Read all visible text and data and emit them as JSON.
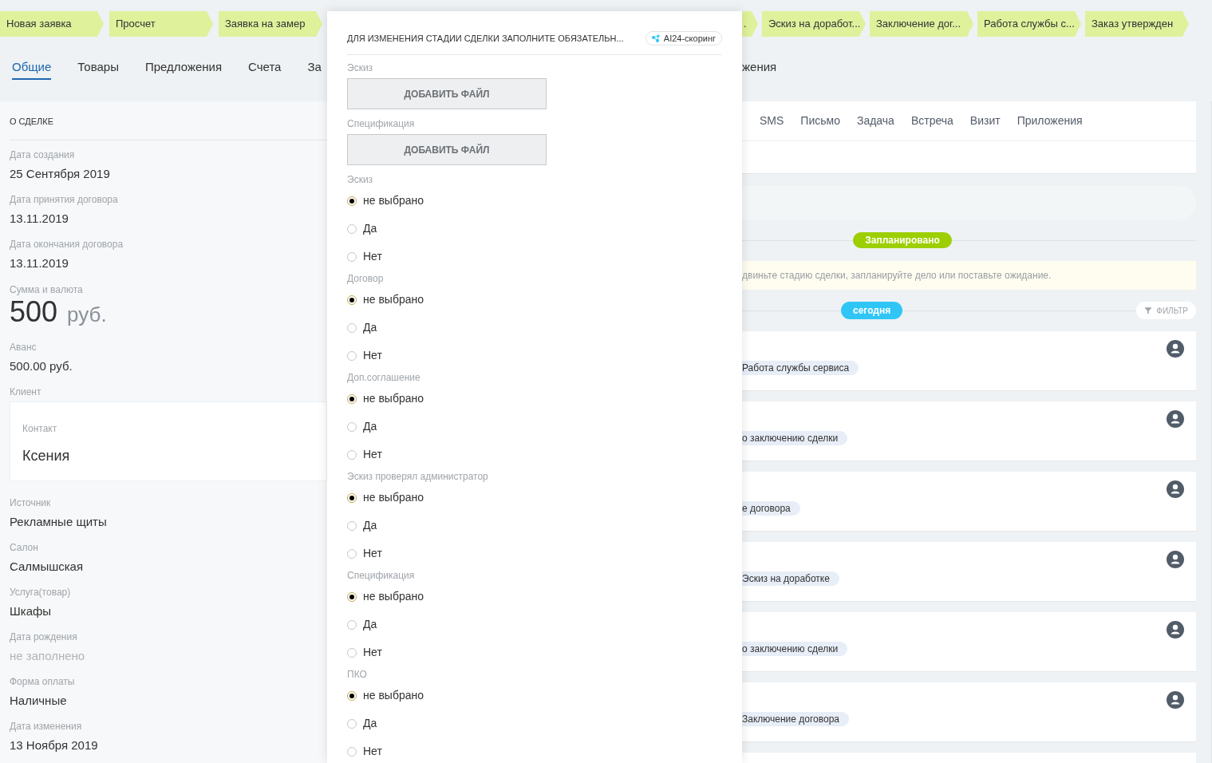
{
  "stages_left": [
    {
      "label": "Новая заявка"
    },
    {
      "label": "Просчет"
    },
    {
      "label": "Заявка на замер"
    }
  ],
  "stages_right": [
    {
      "label": "."
    },
    {
      "label": "Эскиз на доработ..."
    },
    {
      "label": "Заключение дог..."
    },
    {
      "label": "Работа службы с..."
    },
    {
      "label": "Заказ утвержден"
    }
  ],
  "tabs": [
    {
      "label": "Общие",
      "selected": true
    },
    {
      "label": "Товары",
      "selected": false
    },
    {
      "label": "Предложения",
      "selected": false
    },
    {
      "label": "Счета",
      "selected": false
    },
    {
      "label": "За",
      "selected": false
    }
  ],
  "tabs_right": [
    {
      "label": "жения",
      "selected": false
    }
  ],
  "deal": {
    "title": "О СДЕЛКЕ",
    "fields": [
      {
        "kind": "text",
        "label": "Дата создания",
        "value": "25 Сентября 2019"
      },
      {
        "kind": "text",
        "label": "Дата принятия договора",
        "value": "13.11.2019"
      },
      {
        "kind": "text",
        "label": "Дата окончания договора",
        "value": "13.11.2019"
      },
      {
        "kind": "amount",
        "label": "Сумма и валюта",
        "value": "500",
        "currency": "руб."
      },
      {
        "kind": "text",
        "label": "Аванс",
        "value": "500.00 руб."
      },
      {
        "kind": "contact",
        "label": "Клиент",
        "contact_label": "Контакт",
        "value": "Ксения"
      },
      {
        "kind": "text",
        "label": "Источник",
        "value": "Рекламные щиты"
      },
      {
        "kind": "text",
        "label": "Салон",
        "value": "Салмышская"
      },
      {
        "kind": "text",
        "label": "Услуга(товар)",
        "value": "Шкафы"
      },
      {
        "kind": "empty",
        "label": "Дата рождения",
        "value": "не заполнено"
      },
      {
        "kind": "text",
        "label": "Форма оплаты",
        "value": "Наличные"
      },
      {
        "kind": "text",
        "label": "Дата изменения",
        "value": "13 Ноября 2019"
      }
    ]
  },
  "modal": {
    "title": "ДЛЯ ИЗМЕНЕНИЯ СТАДИИ СДЕЛКИ ЗАПОЛНИТЕ ОБЯЗАТЕЛЬН...",
    "badge": "AI24-скоринг",
    "sections": [
      {
        "kind": "file",
        "label": "Эскиз",
        "button": "ДОБАВИТЬ ФАЙЛ"
      },
      {
        "kind": "file",
        "label": "Спецификация",
        "button": "ДОБАВИТЬ ФАЙЛ"
      },
      {
        "kind": "radio",
        "label": "Эскиз",
        "options": [
          {
            "label": "не выбрано",
            "selected": true
          },
          {
            "label": "Да",
            "selected": false
          },
          {
            "label": "Нет",
            "selected": false
          }
        ]
      },
      {
        "kind": "radio",
        "label": "Договор",
        "options": [
          {
            "label": "не выбрано",
            "selected": true
          },
          {
            "label": "Да",
            "selected": false
          },
          {
            "label": "Нет",
            "selected": false
          }
        ]
      },
      {
        "kind": "radio",
        "label": "Доп.соглашение",
        "options": [
          {
            "label": "не выбрано",
            "selected": true
          },
          {
            "label": "Да",
            "selected": false
          },
          {
            "label": "Нет",
            "selected": false
          }
        ]
      },
      {
        "kind": "radio",
        "label": "Эскиз проверял администратор",
        "options": [
          {
            "label": "не выбрано",
            "selected": true
          },
          {
            "label": "Да",
            "selected": false
          },
          {
            "label": "Нет",
            "selected": false
          }
        ]
      },
      {
        "kind": "radio",
        "label": "Спецификация",
        "options": [
          {
            "label": "не выбрано",
            "selected": true
          },
          {
            "label": "Да",
            "selected": false
          },
          {
            "label": "Нет",
            "selected": false
          }
        ]
      },
      {
        "kind": "radio",
        "label": "ПКО",
        "options": [
          {
            "label": "не выбрано",
            "selected": true
          },
          {
            "label": "Да",
            "selected": false
          },
          {
            "label": "Нет",
            "selected": false
          }
        ]
      }
    ]
  },
  "activity_tabs": [
    {
      "label": "SMS"
    },
    {
      "label": "Письмо"
    },
    {
      "label": "Задача"
    },
    {
      "label": "Встреча"
    },
    {
      "label": "Визит"
    },
    {
      "label": "Приложения"
    }
  ],
  "timeline": {
    "planned": "Запланировано",
    "notice": "двиньте стадию сделки, запланируйте дело или поставьте ожидание.",
    "today": "сегодня",
    "filter": "ФИЛЬТР",
    "items": [
      {
        "tag": "Работа службы сервиса"
      },
      {
        "tag": "о заключению сделки"
      },
      {
        "tag": "е договора"
      },
      {
        "tag": "Эскиз на доработке"
      },
      {
        "tag": "о заключению сделки"
      },
      {
        "tag": "Заключение договора"
      }
    ]
  }
}
